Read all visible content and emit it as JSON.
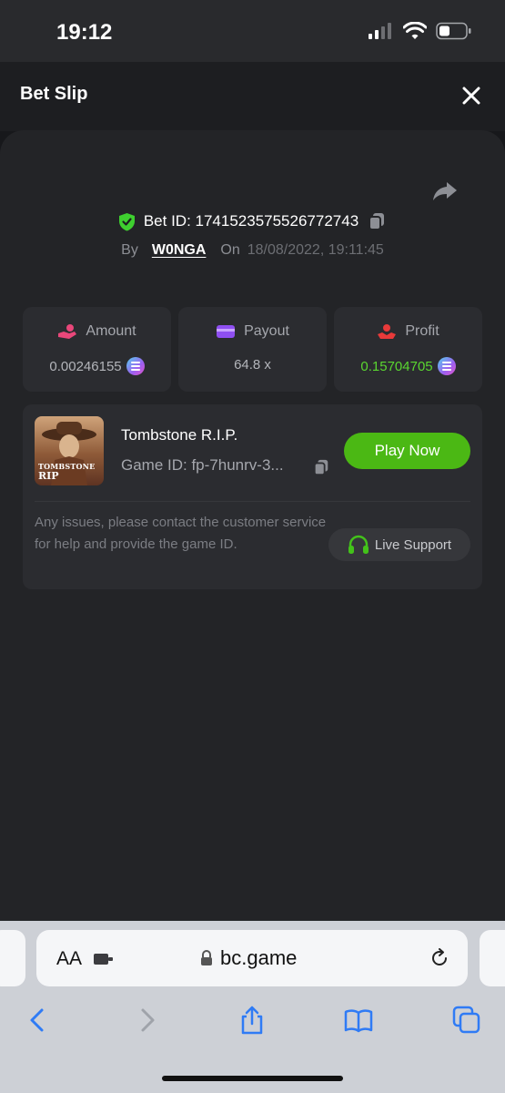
{
  "status_bar": {
    "time": "19:12"
  },
  "header": {
    "title": "Bet Slip"
  },
  "bet": {
    "id_label": "Bet ID: 1741523575526772743",
    "by_label": "By",
    "user": "W0NGA",
    "on_label": "On",
    "date": "18/08/2022, 19:11:45"
  },
  "stats": [
    {
      "label": "Amount",
      "value": "0.00246155",
      "icon": "hand-coins-icon",
      "coin": true
    },
    {
      "label": "Payout",
      "value": "64.8 x",
      "icon": "card-icon",
      "coin": false
    },
    {
      "label": "Profit",
      "value": "0.15704705",
      "icon": "profit-hand-icon",
      "coin": true
    }
  ],
  "game": {
    "title": "Tombstone R.I.P.",
    "id_label": "Game ID: fp-7hunrv-3...",
    "thumb_line1": "TOMBSTONE",
    "thumb_line2": "RIP",
    "play_label": "Play Now",
    "issue_text": "Any issues, please contact the customer service for help and provide the game ID.",
    "support_label": "Live Support"
  },
  "browser": {
    "aa_label": "AA",
    "url": "bc.game"
  },
  "colors": {
    "accent_green": "#4bb814",
    "profit_green": "#5ad630",
    "shield_green": "#3ecf2f"
  }
}
